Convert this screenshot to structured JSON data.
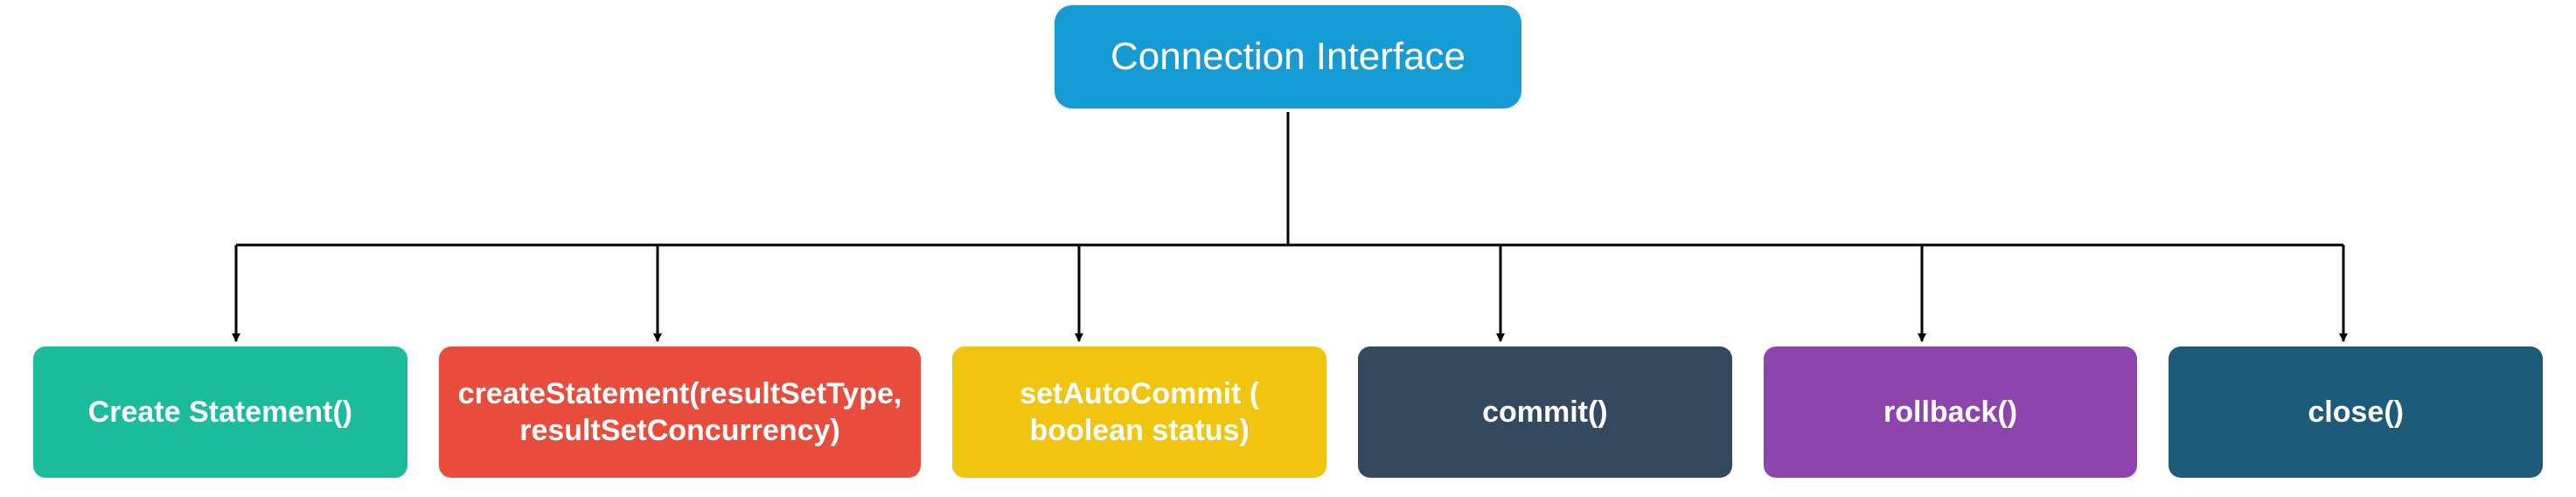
{
  "root": {
    "label": "Connection Interface"
  },
  "children": [
    {
      "label": "Create Statement()",
      "colorClass": "c-teal"
    },
    {
      "label": "createStatement(resultSetType, resultSetConcurrency)",
      "colorClass": "c-red"
    },
    {
      "label": "setAutoCommit ( boolean status)",
      "colorClass": "c-yellow"
    },
    {
      "label": "commit()",
      "colorClass": "c-dark"
    },
    {
      "label": "rollback()",
      "colorClass": "c-purple"
    },
    {
      "label": "close()",
      "colorClass": "c-navy"
    }
  ],
  "chart_data": {
    "type": "tree",
    "root": "Connection Interface",
    "children": [
      "Create Statement()",
      "createStatement(resultSetType, resultSetConcurrency)",
      "setAutoCommit ( boolean status)",
      "commit()",
      "rollback()",
      "close()"
    ]
  }
}
